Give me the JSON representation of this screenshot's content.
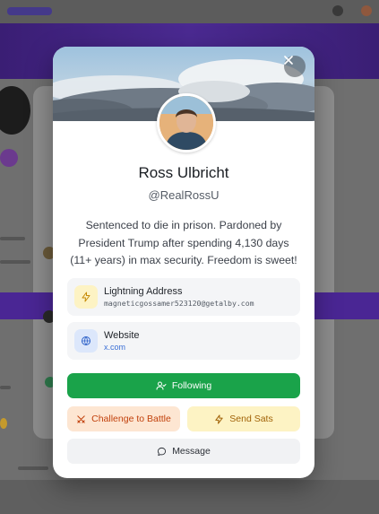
{
  "profile": {
    "name": "Ross Ulbricht",
    "handle": "@RealRossU",
    "bio": "Sentenced to die in prison. Pardoned by President Trump after spending 4,130 days (11+ years) in max security. Freedom is sweet!"
  },
  "lightning": {
    "label": "Lightning Address",
    "value": "magneticgossamer523120@getalby.com",
    "icon": "lightning-icon"
  },
  "website": {
    "label": "Website",
    "value": "x.com",
    "icon": "globe-icon"
  },
  "actions": {
    "following_label": "Following",
    "challenge_label": "Challenge to Battle",
    "send_sats_label": "Send Sats",
    "message_label": "Message"
  },
  "colors": {
    "following_bg": "#1aa34a",
    "challenge_bg": "#fde6d2",
    "challenge_text": "#c2410c",
    "sats_bg": "#fdf3c4",
    "sats_text": "#a16207",
    "message_bg": "#f1f2f4",
    "lightning_tile": "#fdf3c4",
    "website_tile": "#dce7fb"
  }
}
